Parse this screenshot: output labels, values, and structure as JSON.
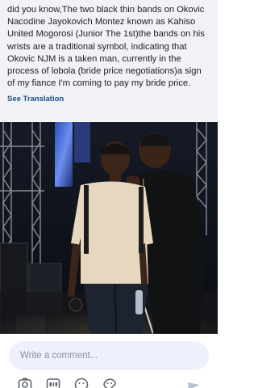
{
  "post": {
    "caption": "did you know,The two black thin bands on Okovic Nacodine Jayokovich Montez known as Kahiso United Mogorosi (Junior The 1st)the bands on his wrists are a traditional symbol, indicating that Okovic NJM is a taken man, currently in the process of lobola (bride price negotiations)a sign of my fiance I'm coming to pay my bride price.",
    "see_translation": "See Translation"
  },
  "comment": {
    "placeholder": "Write a comment..."
  },
  "toolbar": {
    "icons": [
      "camera-icon",
      "gif-icon",
      "emoji-icon",
      "sticker-icon",
      "send-icon"
    ]
  },
  "colors": {
    "post_background": "#f0f2f5",
    "link": "#1a4f8b",
    "comment_background": "#eef1fb",
    "icon": "#606770",
    "send_icon": "#b8c1d6"
  }
}
